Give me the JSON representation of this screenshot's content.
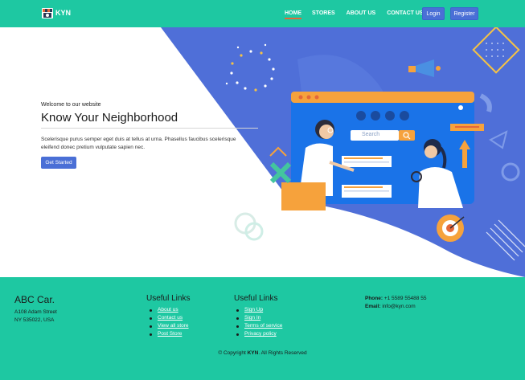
{
  "brand": {
    "name": "KYN"
  },
  "nav": {
    "items": [
      {
        "label": "HOME",
        "active": true
      },
      {
        "label": "STORES",
        "active": false
      },
      {
        "label": "ABOUT US",
        "active": false
      },
      {
        "label": "CONTACT US",
        "active": false
      }
    ],
    "login_label": "Login",
    "register_label": "Register"
  },
  "hero": {
    "welcome": "Welcome to our website",
    "title": "Know Your Neighborhood",
    "description": "Scelerisque purus semper eget duis at tellus at urna. Phasellus faucibus scelerisque eleifend donec pretium vulputate sapien nec.",
    "cta_label": "Get Started",
    "search_placeholder": "Search"
  },
  "footer": {
    "company": "ABC Car.",
    "address_line1": "A108 Adam Street",
    "address_line2": "NY 535022, USA",
    "useful_links_1": {
      "title": "Useful Links",
      "items": [
        "About us",
        "Contact us",
        "View all store",
        "Post Store"
      ]
    },
    "useful_links_2": {
      "title": "Useful Links",
      "items": [
        "Sign Up",
        "Sign In",
        "Terms of service",
        "Privacy policy"
      ]
    },
    "phone_label": "Phone:",
    "phone_value": "+1 5589 55488 55",
    "email_label": "Email:",
    "email_value": "info@kyn.com",
    "copyright_prefix": "© Copyright",
    "copyright_brand": "KYN",
    "copyright_suffix": ". All Rights Reserved"
  },
  "colors": {
    "teal": "#1ec8a2",
    "blue": "#4a6fd6",
    "accent": "#e4673a"
  }
}
